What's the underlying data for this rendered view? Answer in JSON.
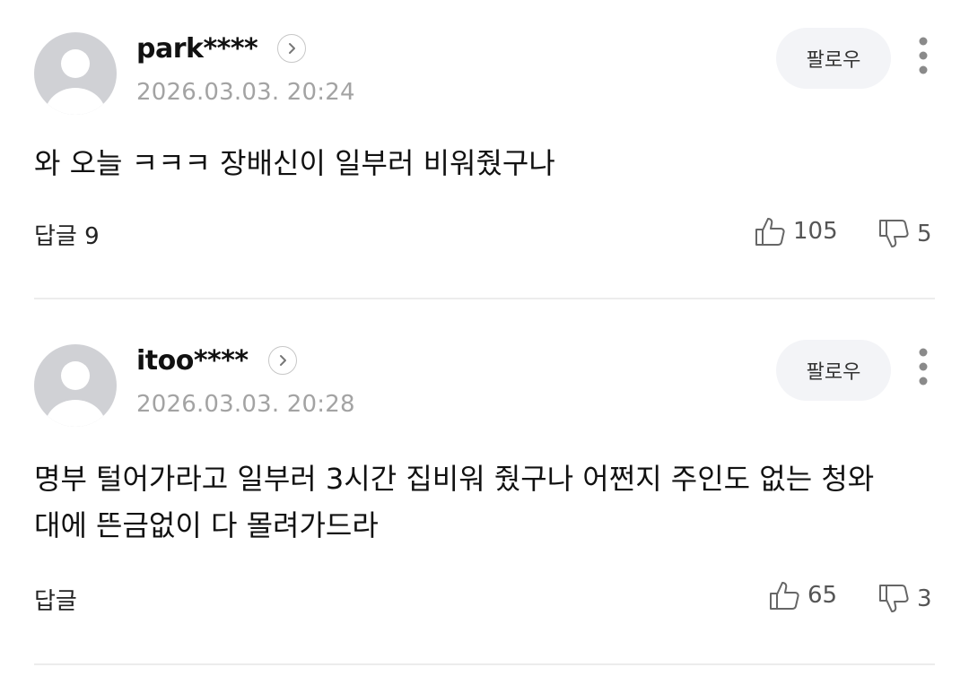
{
  "comments": [
    {
      "username": "park****",
      "date": "2026.03.03. 20:24",
      "follow_label": "팔로우",
      "text": "와 오늘 ㅋㅋㅋ 장배신이 일부러 비워줬구나",
      "reply_label": "답글 9",
      "likes": "105",
      "dislikes": "5"
    },
    {
      "username": "itoo****",
      "date": "2026.03.03. 20:28",
      "follow_label": "팔로우",
      "text": "명부 털어가라고 일부러 3시간 집비워 줬구나 어쩐지 주인도 없는 청와대에 뜬금없이 다 몰려가드라",
      "reply_label": "답글",
      "likes": "65",
      "dislikes": "3"
    }
  ],
  "icons": {
    "avatar": "default-profile-icon",
    "profile_link": "chevron-right-icon",
    "more": "more-vertical-icon",
    "like": "thumbs-up-icon",
    "dislike": "thumbs-down-icon"
  },
  "colors": {
    "avatar_bg": "#d0d1d5",
    "follow_bg": "#f3f4f7",
    "date_text": "#a3a3a3",
    "divider": "#ececec"
  }
}
